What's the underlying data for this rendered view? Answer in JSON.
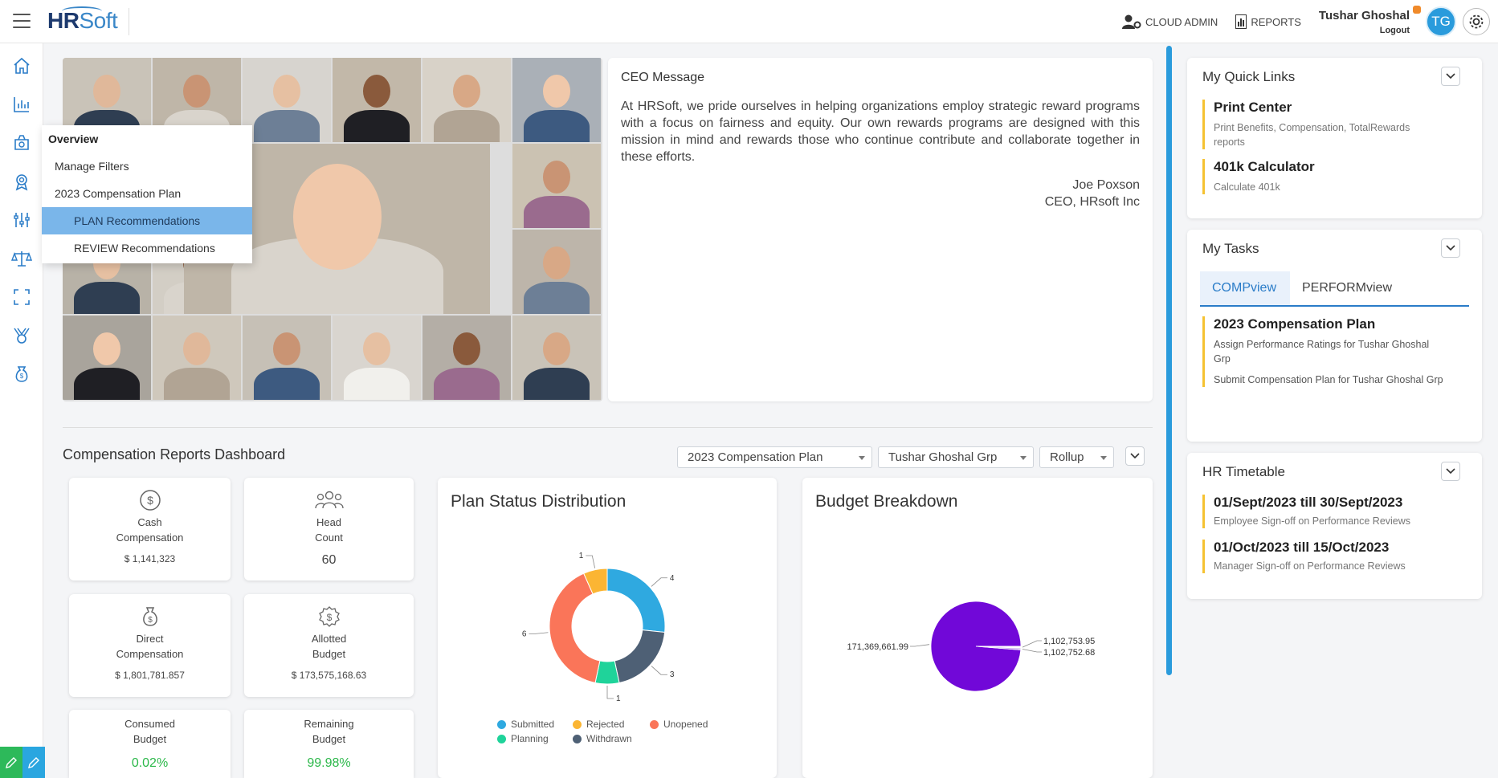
{
  "header": {
    "logo_hr": "HR",
    "logo_soft": "Soft",
    "cloud_admin": "CLOUD ADMIN",
    "reports": "REPORTS",
    "user_name": "Tushar Ghoshal",
    "logout": "Logout",
    "avatar_initials": "TG"
  },
  "sidebar": {
    "icons": [
      "home-icon",
      "bar-chart-icon",
      "money-bag-icon",
      "award-icon",
      "sliders-icon",
      "scale-icon",
      "expand-icon",
      "medal-icon",
      "dollar-bag-icon"
    ]
  },
  "flyout": {
    "items": [
      {
        "label": "Overview",
        "level": "head"
      },
      {
        "label": "Manage Filters",
        "level": "l1"
      },
      {
        "label": "2023 Compensation Plan",
        "level": "l1"
      },
      {
        "label": "PLAN Recommendations",
        "level": "l2",
        "active": true
      },
      {
        "label": "REVIEW Recommendations",
        "level": "l2"
      }
    ]
  },
  "ceo": {
    "title": "CEO Message",
    "text": "At HRSoft, we pride ourselves in helping organizations employ strategic reward programs with a focus on fairness and equity. Our own rewards programs are designed with this mission in mind and rewards those who continue contribute and collaborate together in these efforts.",
    "signer": "Joe Poxson",
    "signer_title": "CEO, HRsoft Inc"
  },
  "dashboard": {
    "title": "Compensation Reports Dashboard",
    "filter_plan": "2023 Compensation Plan",
    "filter_group": "Tushar Ghoshal Grp",
    "filter_view": "Rollup",
    "stats": [
      {
        "label1": "Cash",
        "label2": "Compensation",
        "value": "$ 1,141,323"
      },
      {
        "label1": "Head",
        "label2": "Count",
        "value": "60"
      },
      {
        "label1": "Direct",
        "label2": "Compensation",
        "value": "$ 1,801,781.857"
      },
      {
        "label1": "Allotted",
        "label2": "Budget",
        "value": "$ 173,575,168.63"
      },
      {
        "label1": "Consumed",
        "label2": "Budget",
        "value": "0.02%"
      },
      {
        "label1": "Remaining",
        "label2": "Budget",
        "value": "99.98%"
      }
    ]
  },
  "chart_data": [
    {
      "type": "pie",
      "title": "Plan Status Distribution",
      "categories": [
        "Submitted",
        "Withdrawn",
        "Planning",
        "Unopened",
        "Rejected"
      ],
      "values": [
        4,
        3,
        1,
        6,
        1
      ],
      "colors": [
        "#2fa9e0",
        "#4e6075",
        "#1fd39a",
        "#fa7559",
        "#fbb533"
      ],
      "donut": true,
      "legend": "bottom"
    },
    {
      "type": "pie",
      "title": "Budget Breakdown",
      "values": [
        171369661.99,
        1102753.95,
        1102752.68
      ],
      "data_labels": [
        "171,369,661.99",
        "1,102,753.95",
        "1,102,752.68"
      ],
      "colors": [
        "#7108d8",
        "#ffffff",
        "#c8a8f0"
      ]
    }
  ],
  "quick_links": {
    "title": "My Quick Links",
    "items": [
      {
        "title": "Print Center",
        "sub": "Print Benefits, Compensation, TotalRewards reports"
      },
      {
        "title": "401k Calculator",
        "sub": "Calculate 401k"
      }
    ]
  },
  "tasks": {
    "title": "My Tasks",
    "tab_active": "COMPview",
    "tab_inactive": "PERFORMview",
    "plan_title": "2023 Compensation Plan",
    "task1": "Assign Performance Ratings for Tushar Ghoshal Grp",
    "task2": "Submit Compensation Plan for Tushar Ghoshal Grp"
  },
  "timetable": {
    "title": "HR Timetable",
    "items": [
      {
        "title": "01/Sept/2023 till 30/Sept/2023",
        "sub": "Employee Sign-off on Performance Reviews"
      },
      {
        "title": "01/Oct/2023 till 15/Oct/2023",
        "sub": "Manager Sign-off on Performance Reviews"
      }
    ]
  }
}
